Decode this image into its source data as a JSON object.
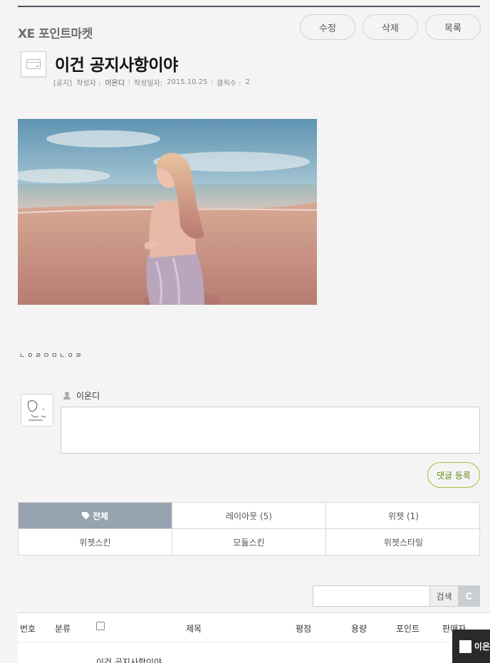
{
  "brand": "XE 포인트마켓",
  "actions": {
    "edit": "수정",
    "delete": "삭제",
    "list": "목록"
  },
  "post": {
    "title": "이건 공지사항이야",
    "notice_tag": "[공지]",
    "author_label": "작성자 :",
    "author": "이온디",
    "date_label": "작성일자:",
    "date": "2015.10.25",
    "views_label": "클릭수 :",
    "views": "2",
    "body": "ㄴㅇㄹㅁㅁㄴㅇㄹ"
  },
  "comment": {
    "user": "이온디",
    "submit": "댓글 등록"
  },
  "categories": [
    {
      "label": "전체",
      "active": true
    },
    {
      "label": "레이아웃 (5)"
    },
    {
      "label": "위젯 (1)"
    },
    {
      "label": "위젯스킨"
    },
    {
      "label": "모듈스킨"
    },
    {
      "label": "위젯스타일"
    }
  ],
  "search": {
    "button": "검색"
  },
  "table": {
    "headers": {
      "no": "번호",
      "category": "분류",
      "title": "제목",
      "rating": "평점",
      "size": "용량",
      "point": "포인트",
      "seller": "판매자"
    },
    "first_row_title": "이건 공지사항이야"
  },
  "floating_user": "이온"
}
